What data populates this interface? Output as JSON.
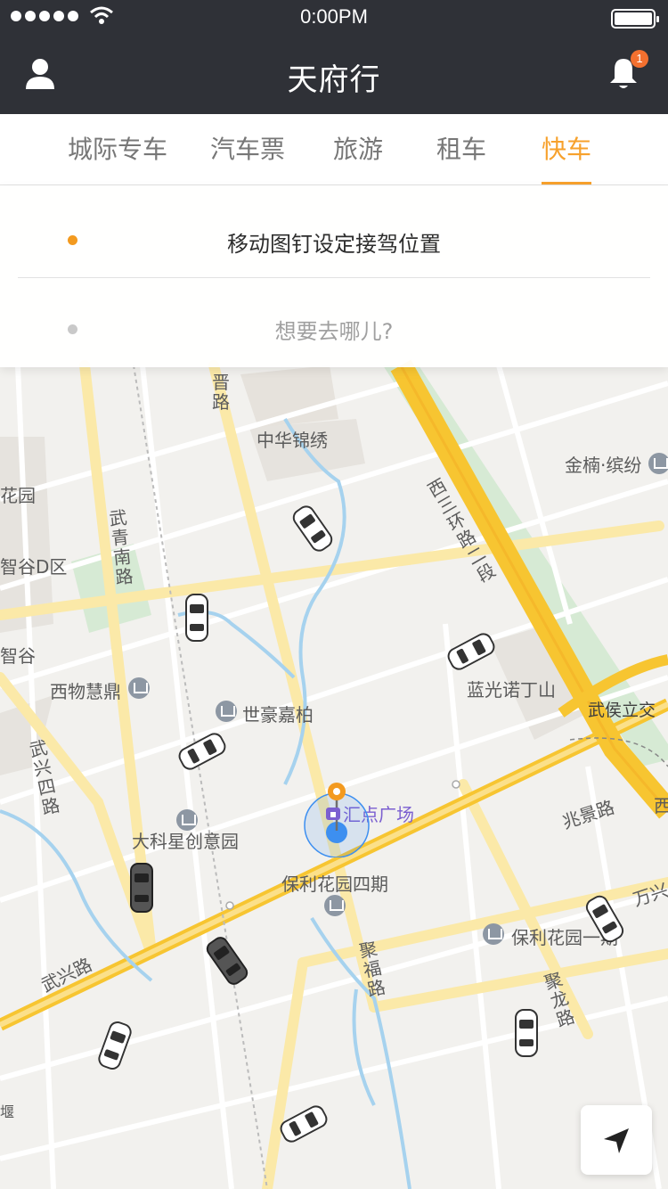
{
  "status_bar": {
    "time": "0:00PM"
  },
  "header": {
    "title": "天府行",
    "notification_count": "1",
    "left_icon": "user-icon",
    "right_icon": "bell-icon"
  },
  "tabs": [
    {
      "label": "城际专车",
      "active": false
    },
    {
      "label": "汽车票",
      "active": false
    },
    {
      "label": "旅游",
      "active": false
    },
    {
      "label": "租车",
      "active": false
    },
    {
      "label": "快车",
      "active": true
    }
  ],
  "booking": {
    "pickup_text": "移动图钉设定接驾位置",
    "destination_placeholder": "想要去哪儿?"
  },
  "map": {
    "labels": {
      "zhonghua_jinxiu": "中华锦绣",
      "jinnan_binfen": "金楠·缤纷",
      "huayuan": "花园",
      "zhigu_d": "智谷D区",
      "zhigu": "智谷",
      "wuqingnan_road": "武青南路",
      "xiwu_huiding": "西物慧鼎",
      "shihao_jiabo": "世豪嘉柏",
      "languang_nuodingshan": "蓝光诺丁山",
      "wuhou_lijiao": "武侯立交",
      "wuxing_4_road": "武兴四路",
      "huidian_plaza": "汇点广场",
      "dakexing": "大科星创意园",
      "baoli_4": "保利花园四期",
      "zhaojing_road": "兆景路",
      "wanxing": "万兴",
      "baoli_1": "保利花园一期",
      "jufu_road": "聚福路",
      "julong_road": "聚龙路",
      "wuxing_road": "武兴路",
      "xisanhuan": "西三环路二段",
      "jin_road": "晋路",
      "xi": "西",
      "yan": "堰"
    },
    "accent_road_color": "#f7c531",
    "pin_color": "#f39a1f",
    "location_color": "#3d8ff0"
  },
  "locate_button": {
    "icon": "navigation-arrow-icon"
  }
}
